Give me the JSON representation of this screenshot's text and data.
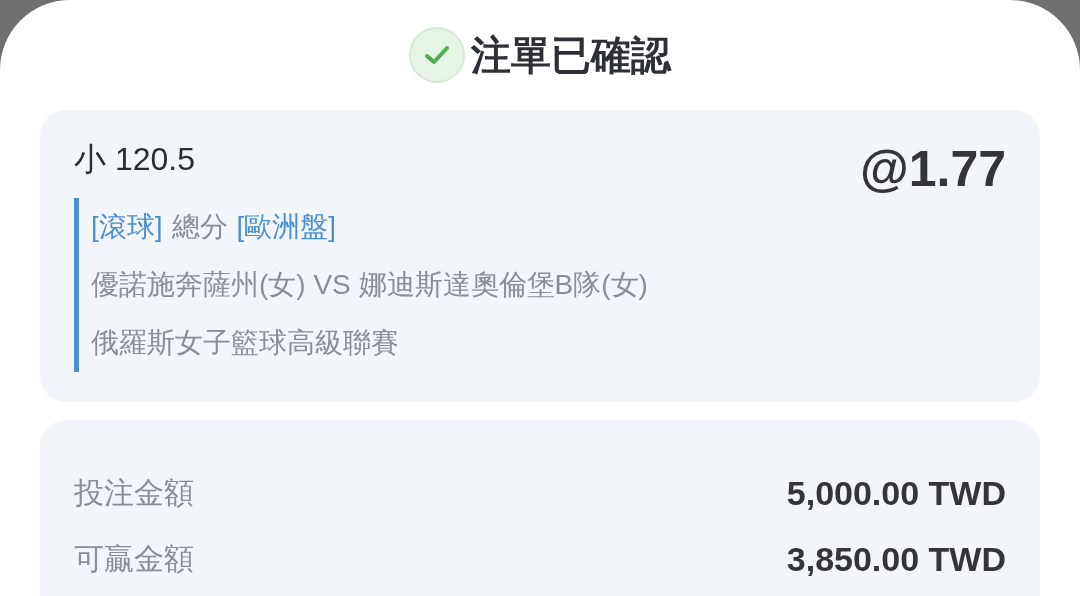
{
  "title": "注單已確認",
  "bet": {
    "selection": "小 120.5",
    "odds": "@1.77",
    "market": [
      {
        "text": "[滾球]",
        "kind": "tag"
      },
      {
        "text": "總分",
        "kind": "plain"
      },
      {
        "text": "[歐洲盤]",
        "kind": "tag"
      }
    ],
    "match": "優諾施奔薩州(女) VS 娜迪斯達奧倫堡B隊(女)",
    "league": "俄羅斯女子籃球高級聯賽"
  },
  "summary": [
    {
      "label": "投注金額",
      "value": "5,000.00 TWD"
    },
    {
      "label": "可贏金額",
      "value": "3,850.00 TWD"
    }
  ]
}
